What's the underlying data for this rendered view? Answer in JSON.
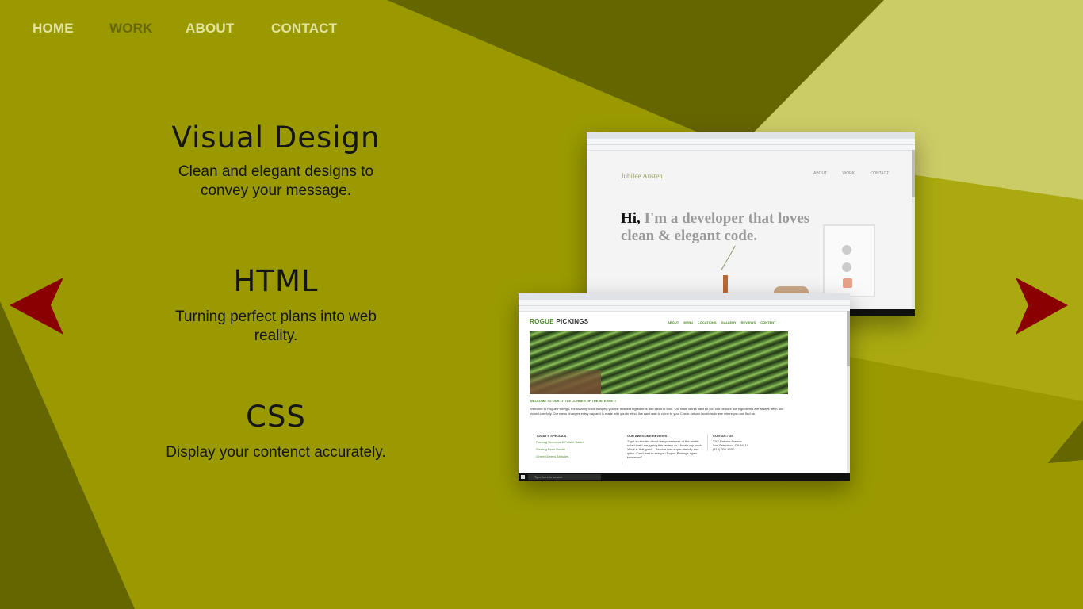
{
  "nav": {
    "items": [
      {
        "label": "HOME",
        "active": false
      },
      {
        "label": "WORK",
        "active": true
      },
      {
        "label": "ABOUT",
        "active": false
      },
      {
        "label": "CONTACT",
        "active": false
      }
    ]
  },
  "sections": [
    {
      "title": "Visual Design",
      "text": "Clean and elegant designs to convey your message."
    },
    {
      "title": "HTML",
      "text": "Turning perfect plans into web reality."
    },
    {
      "title": "CSS",
      "text": "Display your contenct accurately."
    }
  ],
  "carousel": {
    "prev_icon": "arrow-left-icon",
    "next_icon": "arrow-right-icon",
    "arrow_color": "#8a0000"
  },
  "screenshot_back": {
    "logo": "Jubilee Austen",
    "nav": [
      "ABOUT",
      "WORK",
      "CONTACT"
    ],
    "hero_bold": "Hi,",
    "hero_rest_line1": "I'm a developer that loves",
    "hero_line2": "clean & elegant code."
  },
  "screenshot_front": {
    "logo_primary": "ROGUE",
    "logo_secondary": "PICKINGS",
    "nav": [
      "ABOUT",
      "MENU",
      "LOCATIONS",
      "GALLERY",
      "REVIEWS",
      "CONTENT"
    ],
    "welcome": "WELCOME TO OUR LITTLE CORNER OF THE INTERNET!",
    "intro": "Welcome to Rogue Pickings, the roaming truck bringing you the freshest ingredients and ideas in food. Our team works hard so you can be sure our ingredients are always fresh and picked carefully. Our menu changes every day and is made with you in mind. We can't wait to come to you! Check out our locations to see where you can find us.",
    "specials_heading": "TODAY'S SPECIALS",
    "specials": [
      "Flaming Hummus & Falafel Salad",
      "Sizzling Bean Burrito",
      "Green Greens Tamales"
    ],
    "review_heading": "OUR AWESOME REVIEWS",
    "review_text": "\"I got so excited about the yumminess of the falafel salad that I am typing this review as I inhale my lunch. Yes it is that good... Service was super friendly and quick. Can't wait to see you Rogue Pickings again tomorrow!\"",
    "contact_heading": "CONTACT US",
    "contact_lines": [
      "XXX Potrero Avenue",
      "San Francisco, CA 94110",
      "(415) 206-8000"
    ],
    "search_placeholder": "Type here to search"
  },
  "colors": {
    "background": "#9a9a00",
    "accent_green": "#4c8a2a",
    "nav_inactive": "#e3e3a2",
    "nav_active": "#66660a"
  }
}
